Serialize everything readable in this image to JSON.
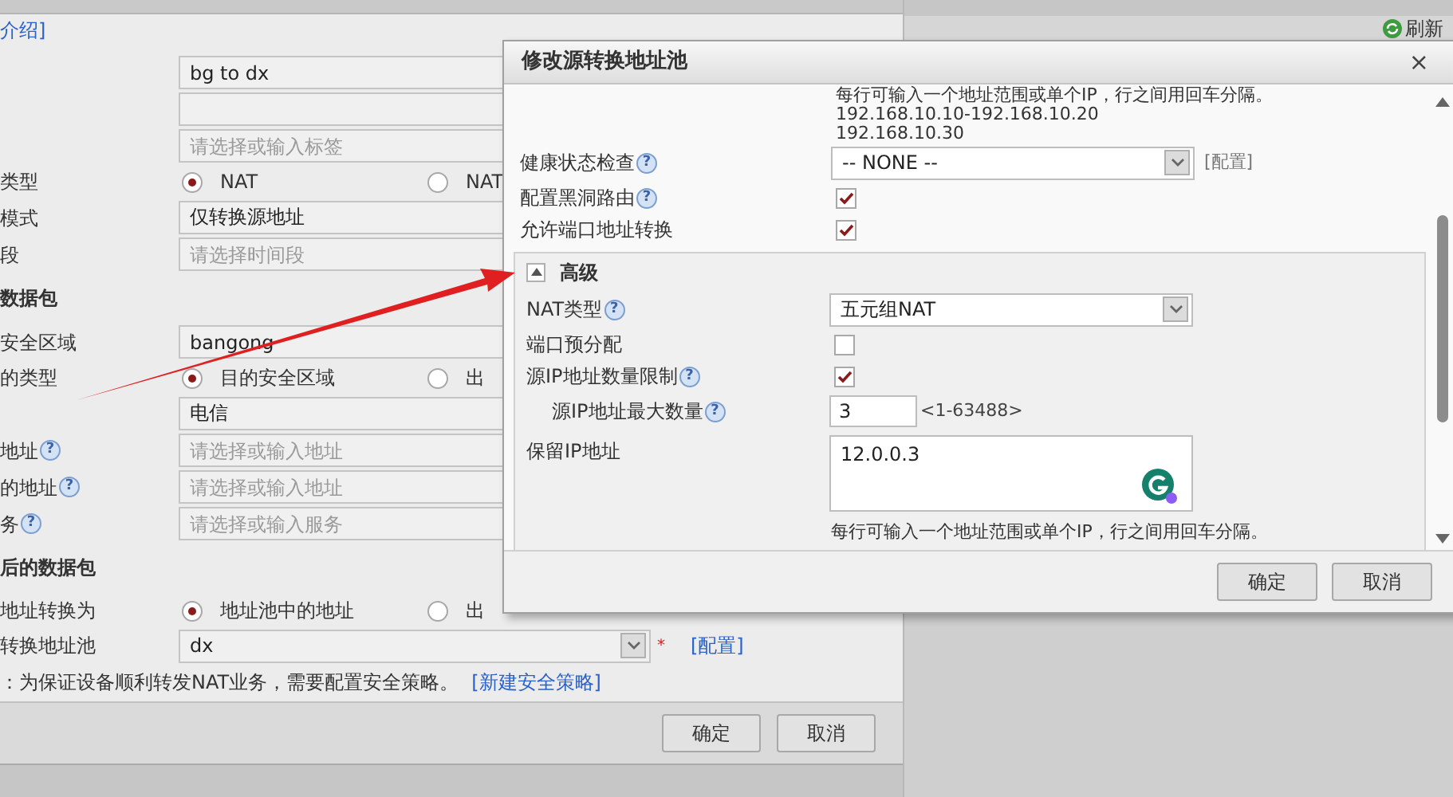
{
  "background_form": {
    "intro_link": "介绍]",
    "rows": [
      {
        "kind": "field",
        "value": "bg to dx"
      },
      {
        "kind": "field"
      },
      {
        "kind": "field",
        "placeholder": "请选择或输入标签"
      },
      {
        "kind": "radio",
        "label": "类型",
        "options": [
          {
            "label": "NAT",
            "selected": true
          },
          {
            "label": "NAT",
            "selected": false
          }
        ]
      },
      {
        "kind": "field",
        "label": "模式",
        "value": "仅转换源地址"
      },
      {
        "kind": "field",
        "label": "段",
        "placeholder": "请选择时间段"
      },
      {
        "kind": "section",
        "label": "数据包"
      },
      {
        "kind": "field",
        "label": "安全区域",
        "value": "bangong"
      },
      {
        "kind": "radio",
        "label": "的类型",
        "options": [
          {
            "label": "目的安全区域",
            "selected": true
          },
          {
            "label": "出",
            "selected": false
          }
        ]
      },
      {
        "kind": "field",
        "value": "电信"
      },
      {
        "kind": "field",
        "label": "地址",
        "help": "?",
        "placeholder": "请选择或输入地址"
      },
      {
        "kind": "field",
        "label": "的地址",
        "help": "?",
        "placeholder": "请选择或输入地址"
      },
      {
        "kind": "field",
        "label": "务",
        "help": "?",
        "placeholder": "请选择或输入服务"
      },
      {
        "kind": "section",
        "label": "后的数据包"
      },
      {
        "kind": "radio",
        "label": "地址转换为",
        "options": [
          {
            "label": "地址池中的地址",
            "selected": true
          },
          {
            "label": "出",
            "selected": false
          }
        ]
      },
      {
        "kind": "select",
        "label": "转换地址池",
        "value": "dx",
        "required_mark": "*",
        "link": "[配置]"
      }
    ],
    "note": {
      "text": "：为保证设备顺利转发NAT业务，需要配置安全策略。",
      "link": "[新建安全策略]"
    },
    "buttons": [
      "确定",
      "取消"
    ]
  },
  "toolbar": {
    "refresh": "刷新"
  },
  "dialog": {
    "title": "修改源转换地址池",
    "close": "×",
    "top_hints": [
      "每行可输入一个地址范围或单个IP，行之间用回车分隔。",
      "192.168.10.10-192.168.10.20",
      "192.168.10.30"
    ],
    "rows": [
      {
        "kind": "select",
        "label": "健康状态检查",
        "help": "?",
        "value": "-- NONE --",
        "link": "[配置]"
      },
      {
        "kind": "checkbox",
        "label": "配置黑洞路由",
        "help": "?",
        "checked": true
      },
      {
        "kind": "checkbox",
        "label": "允许端口地址转换",
        "checked": true
      }
    ],
    "advanced": {
      "title": "高级",
      "expanded": true,
      "rows": [
        {
          "kind": "select",
          "label": "NAT类型",
          "help": "?",
          "value": "五元组NAT"
        },
        {
          "kind": "checkbox",
          "label": "端口预分配",
          "checked": false
        },
        {
          "kind": "checkbox",
          "label": "源IP地址数量限制",
          "help": "?",
          "checked": true,
          "children": [
            {
              "kind": "number",
              "label": "源IP地址最大数量",
              "help": "?",
              "value": "3",
              "range": "<1-63488>"
            }
          ]
        },
        {
          "kind": "textarea",
          "label": "保留IP地址",
          "value": "12.0.0.3"
        }
      ],
      "hint": "每行可输入一个地址范围或单个IP，行之间用回车分隔。"
    },
    "buttons": [
      "确定",
      "取消"
    ]
  }
}
